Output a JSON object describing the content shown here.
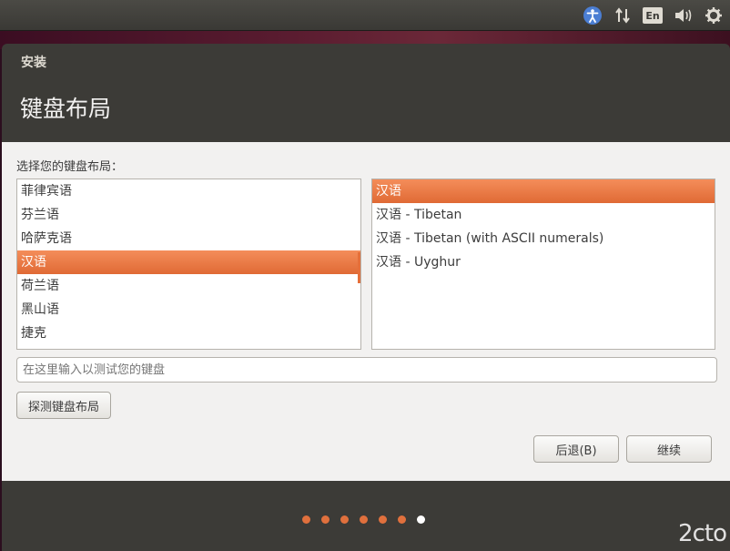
{
  "system_tray": {
    "icons": [
      "accessibility-icon",
      "network-icon",
      "keyboard-indicator",
      "volume-icon",
      "settings-gear-icon"
    ],
    "keyboard_indicator_label": "En"
  },
  "window": {
    "title": "安装",
    "heading": "键盘布局"
  },
  "content": {
    "prompt": "选择您的键盘布局：",
    "layouts": [
      {
        "label": "菲律宾语",
        "selected": false
      },
      {
        "label": "芬兰语",
        "selected": false
      },
      {
        "label": "哈萨克语",
        "selected": false
      },
      {
        "label": "汉语",
        "selected": true
      },
      {
        "label": "荷兰语",
        "selected": false
      },
      {
        "label": "黑山语",
        "selected": false
      },
      {
        "label": "捷克",
        "selected": false
      }
    ],
    "variants": [
      {
        "label": "汉语",
        "selected": true
      },
      {
        "label": "汉语 - Tibetan",
        "selected": false
      },
      {
        "label": "汉语 - Tibetan (with ASCII numerals)",
        "selected": false
      },
      {
        "label": "汉语 - Uyghur",
        "selected": false
      }
    ],
    "test_input": {
      "value": "",
      "placeholder": "在这里输入以测试您的键盘"
    },
    "detect_button": "探测键盘布局",
    "back_button": "后退(B)",
    "continue_button": "继续"
  },
  "progress": {
    "total_steps": 7,
    "current_step": 7
  },
  "colors": {
    "accent": "#e06a35",
    "window_bg": "#3c3b37",
    "content_bg": "#f2f1f0"
  },
  "watermark": "2cto"
}
